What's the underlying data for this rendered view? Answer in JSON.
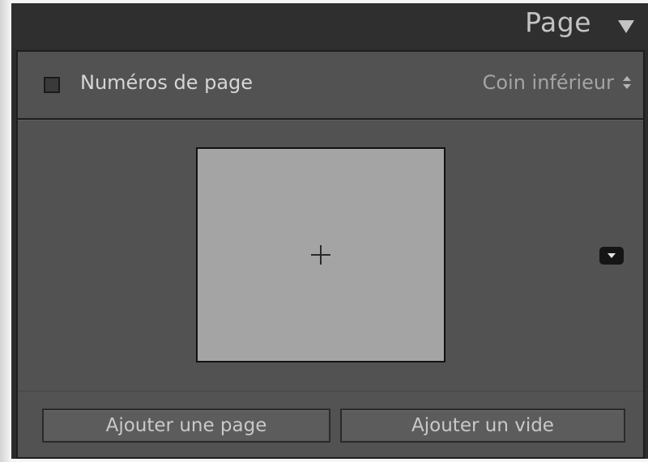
{
  "panel": {
    "title": "Page",
    "collapse_icon": "triangle-down-icon"
  },
  "page_numbers": {
    "checked": false,
    "label": "Numéros de page",
    "position_value": "Coin inférieur",
    "position_icon": "up-down-arrows-icon"
  },
  "page_preview": {
    "slot_icon": "plus-icon",
    "options_icon": "dropdown-triangle-icon"
  },
  "buttons": {
    "add_page": "Ajouter une page",
    "add_blank": "Ajouter un vide"
  },
  "colors": {
    "panel_bg": "#525252",
    "header_bg": "#2f2f2f",
    "slot_bg": "#a4a4a4",
    "text": "#d6d6d6"
  }
}
